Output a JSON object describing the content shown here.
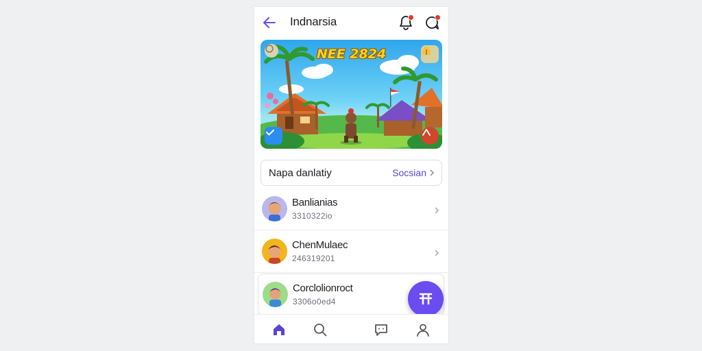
{
  "header": {
    "title": "Indnarsia",
    "back_icon": "arrow-left-icon",
    "right_icons": [
      "notification-bell-icon",
      "chat-icon"
    ],
    "accent": "#6a4cf0"
  },
  "banner": {
    "title": "NEE 2824",
    "badges": [
      "coin-icon",
      "gift-icon",
      "check-icon",
      "share-icon"
    ]
  },
  "section": {
    "label": "Napa danlatiy",
    "action": "Socsian"
  },
  "list": [
    {
      "name": "Banlianias",
      "sub": "3310322io"
    },
    {
      "name": "ChenMulaec",
      "sub": "246319201"
    },
    {
      "name": "Corclolionroct",
      "sub": "3306o0ed4"
    }
  ],
  "fab": {
    "icon": "compose-icon"
  },
  "bottom_nav": [
    "home-icon",
    "search-icon",
    "messages-icon",
    "profile-icon"
  ]
}
